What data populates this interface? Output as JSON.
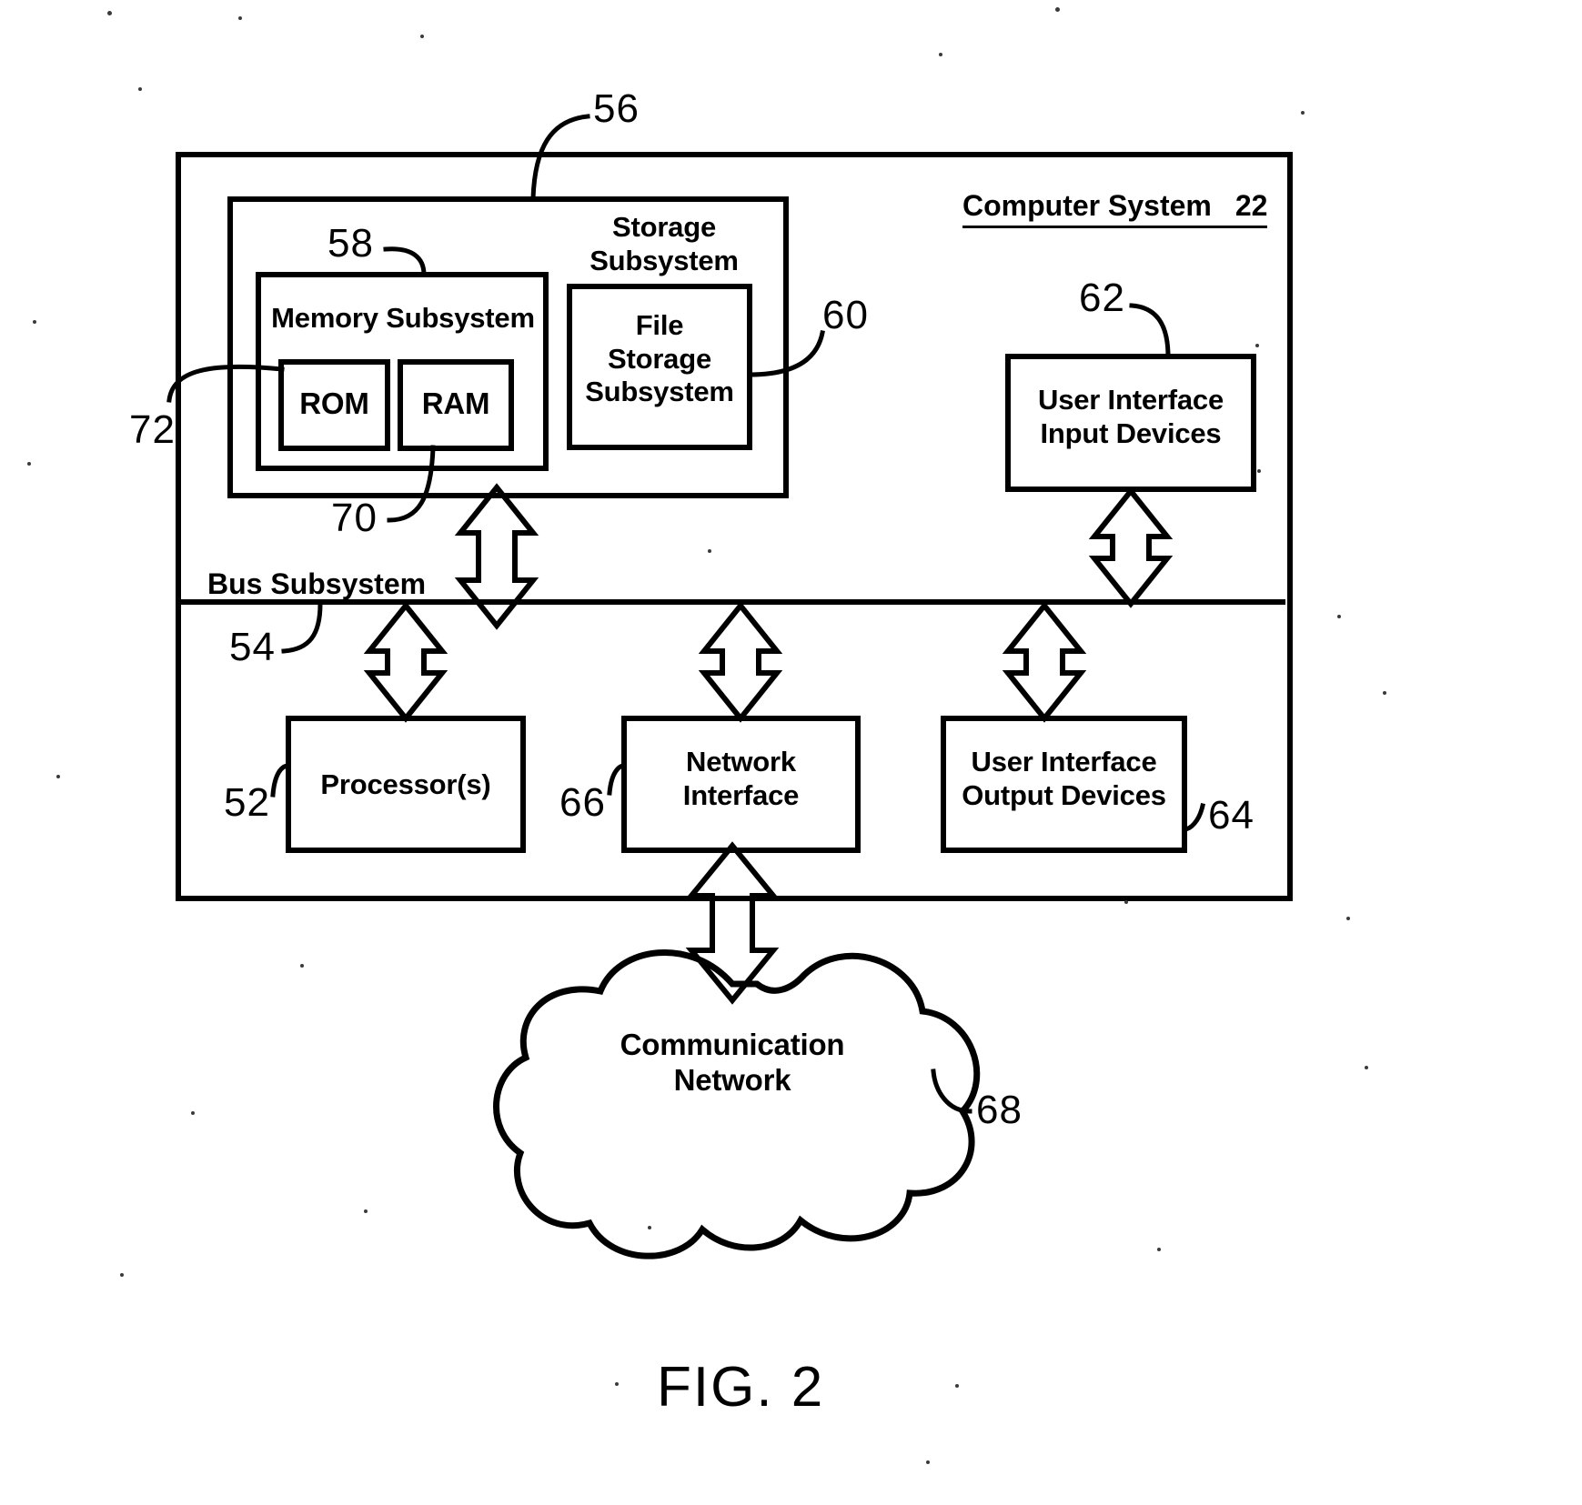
{
  "figure": {
    "caption": "FIG. 2",
    "title_label": "Computer System",
    "title_refnum": "22"
  },
  "boxes": {
    "computer_system": {
      "label": "Computer System",
      "refnum": "22"
    },
    "storage_subsystem": {
      "label": "Storage\nSubsystem",
      "refnum": "56"
    },
    "memory_subsystem": {
      "label": "Memory Subsystem",
      "refnum": "58"
    },
    "rom": {
      "label": "ROM",
      "refnum": "72"
    },
    "ram": {
      "label": "RAM",
      "refnum": "70"
    },
    "file_storage_subsystem": {
      "label": "File\nStorage\nSubsystem",
      "refnum": "60"
    },
    "user_interface_input_devices": {
      "label": "User Interface\nInput Devices",
      "refnum": "62"
    },
    "bus_subsystem": {
      "label": "Bus Subsystem",
      "refnum": "54"
    },
    "processors": {
      "label": "Processor(s)",
      "refnum": "52"
    },
    "network_interface": {
      "label": "Network\nInterface",
      "refnum": "66"
    },
    "user_interface_output_devices": {
      "label": "User Interface\nOutput Devices",
      "refnum": "64"
    },
    "communication_network": {
      "label": "Communication Network",
      "refnum": "68"
    }
  },
  "refnums": {
    "n22": "22",
    "n52": "52",
    "n54": "54",
    "n56": "56",
    "n58": "58",
    "n60": "60",
    "n62": "62",
    "n64": "64",
    "n66": "66",
    "n68": "68",
    "n70": "70",
    "n72": "72"
  },
  "colors": {
    "ink": "#000000",
    "paper": "#ffffff"
  },
  "diagram": {
    "type": "block-diagram",
    "connections": [
      {
        "from": "storage_subsystem",
        "to": "bus_subsystem",
        "style": "double-arrow-vertical"
      },
      {
        "from": "processors",
        "to": "bus_subsystem",
        "style": "double-arrow-vertical"
      },
      {
        "from": "network_interface",
        "to": "bus_subsystem",
        "style": "double-arrow-vertical"
      },
      {
        "from": "user_interface_output_devices",
        "to": "bus_subsystem",
        "style": "double-arrow-vertical"
      },
      {
        "from": "user_interface_input_devices",
        "to": "bus_subsystem",
        "style": "double-arrow-vertical"
      },
      {
        "from": "network_interface",
        "to": "communication_network",
        "style": "double-arrow-vertical"
      }
    ]
  }
}
